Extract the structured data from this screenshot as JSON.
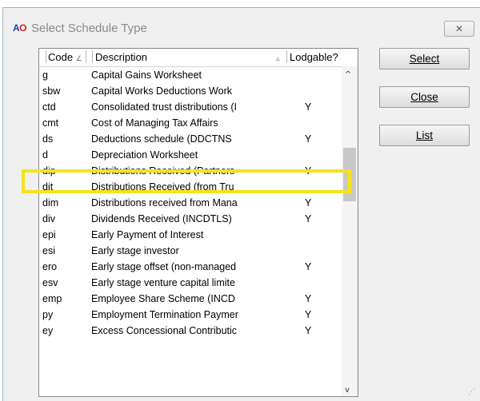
{
  "window": {
    "icon_text_a": "A",
    "icon_text_o": "O",
    "title": "Select Schedule Type",
    "close_label": "✕"
  },
  "columns": {
    "code": "Code",
    "description": "Description",
    "lodgable": "Lodgable?"
  },
  "rows": [
    {
      "code": "g",
      "description": "Capital Gains Worksheet",
      "lodgable": "",
      "checked": false
    },
    {
      "code": "sbw",
      "description": "Capital Works Deductions Work",
      "lodgable": "",
      "checked": false
    },
    {
      "code": "ctd",
      "description": "Consolidated trust distributions (I",
      "lodgable": "Y",
      "checked": false
    },
    {
      "code": "cmt",
      "description": "Cost of Managing Tax Affairs",
      "lodgable": "",
      "checked": true
    },
    {
      "code": "ds",
      "description": "Deductions schedule (DDCTNS",
      "lodgable": "Y",
      "checked": true
    },
    {
      "code": "d",
      "description": "Depreciation Worksheet",
      "lodgable": "",
      "checked": false
    },
    {
      "code": "dip",
      "description": "Distributions Received (Partners",
      "lodgable": "Y",
      "checked": false
    },
    {
      "code": "dit",
      "description": "Distributions Received (from Tru",
      "lodgable": "",
      "checked": false
    },
    {
      "code": "dim",
      "description": "Distributions received from Mana",
      "lodgable": "Y",
      "checked": false
    },
    {
      "code": "div",
      "description": "Dividends Received (INCDTLS)",
      "lodgable": "Y",
      "checked": false
    },
    {
      "code": "epi",
      "description": "Early Payment of Interest",
      "lodgable": "",
      "checked": false
    },
    {
      "code": "esi",
      "description": "Early stage investor",
      "lodgable": "",
      "checked": false
    },
    {
      "code": "ero",
      "description": "Early stage offset (non-managed",
      "lodgable": "Y",
      "checked": false
    },
    {
      "code": "esv",
      "description": "Early stage venture capital limite",
      "lodgable": "",
      "checked": false
    },
    {
      "code": "emp",
      "description": "Employee Share Scheme (INCD",
      "lodgable": "Y",
      "checked": false
    },
    {
      "code": "py",
      "description": "Employment Termination Paymer",
      "lodgable": "Y",
      "checked": false
    },
    {
      "code": "ey",
      "description": "Excess Concessional Contributic",
      "lodgable": "Y",
      "checked": false
    }
  ],
  "buttons": {
    "select": "Select",
    "close": "Close",
    "list": "List"
  },
  "icons": {
    "sort": "sort-triangle-icon",
    "check": "green-check-icon",
    "scroll_up": "scroll-up-arrow-icon",
    "scroll_down": "scroll-down-arrow-icon"
  },
  "colors": {
    "highlight": "#f5e31a",
    "check": "#1aa43a",
    "logo_blue": "#1f3fb0",
    "logo_red": "#d8202a"
  }
}
